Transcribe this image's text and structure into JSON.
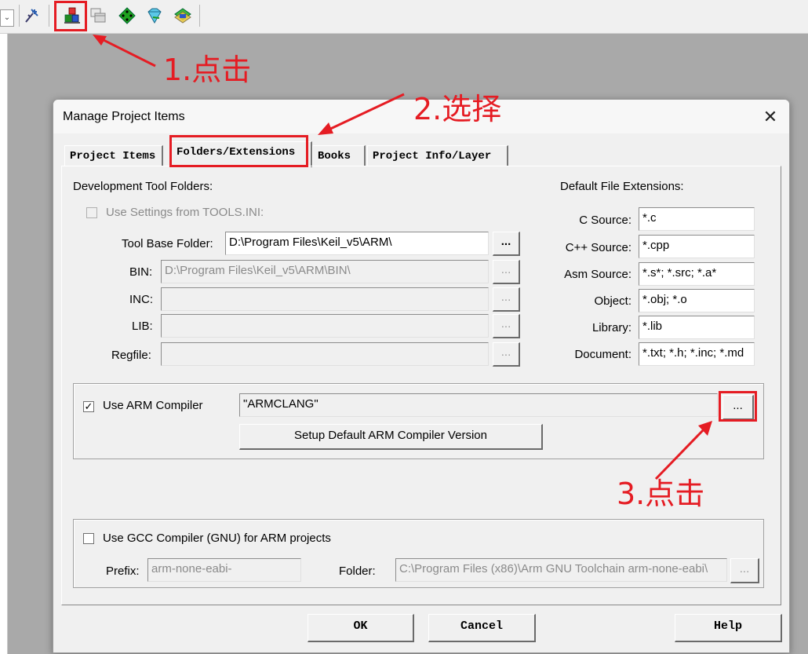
{
  "dialog": {
    "title": "Manage Project Items",
    "close_glyph": "✕",
    "tabs": [
      {
        "label": "Project Items"
      },
      {
        "label": "Folders/Extensions"
      },
      {
        "label": "Books"
      },
      {
        "label": "Project Info/Layer"
      }
    ],
    "active_tab": "Folders/Extensions"
  },
  "folders": {
    "section_title": "Development Tool Folders:",
    "use_tools_ini": {
      "label": "Use Settings from TOOLS.INI:",
      "checked": false
    },
    "tool_base": {
      "label": "Tool Base Folder:",
      "value": "D:\\Program Files\\Keil_v5\\ARM\\"
    },
    "bin": {
      "label": "BIN:",
      "value": "D:\\Program Files\\Keil_v5\\ARM\\BIN\\"
    },
    "inc": {
      "label": "INC:",
      "value": ""
    },
    "lib": {
      "label": "LIB:",
      "value": ""
    },
    "regfile": {
      "label": "Regfile:",
      "value": ""
    },
    "browse_label": "..."
  },
  "extensions": {
    "section_title": "Default File Extensions:",
    "c_source": {
      "label": "C Source:",
      "value": "*.c"
    },
    "cpp_source": {
      "label": "C++ Source:",
      "value": "*.cpp"
    },
    "asm_source": {
      "label": "Asm Source:",
      "value": "*.s*; *.src; *.a*"
    },
    "object": {
      "label": "Object:",
      "value": "*.obj; *.o"
    },
    "library": {
      "label": "Library:",
      "value": "*.lib"
    },
    "document": {
      "label": "Document:",
      "value": "*.txt; *.h; *.inc; *.md"
    }
  },
  "arm_compiler": {
    "checkbox_label": "Use ARM Compiler",
    "checked": true,
    "check_glyph": "✓",
    "value": "\"ARMCLANG\"",
    "browse_label": "...",
    "setup_button": "Setup Default ARM Compiler Version"
  },
  "gcc": {
    "checkbox_label": "Use GCC Compiler (GNU) for ARM projects",
    "checked": false,
    "prefix_label": "Prefix:",
    "prefix_value": "arm-none-eabi-",
    "folder_label": "Folder:",
    "folder_value": "C:\\Program Files (x86)\\Arm GNU Toolchain arm-none-eabi\\",
    "browse_label": "..."
  },
  "footer": {
    "ok": "OK",
    "cancel": "Cancel",
    "help": "Help"
  },
  "annotations": {
    "step1": "1.点击",
    "step2": "2.选择",
    "step3": "3.点击",
    "color": "#e51c23"
  },
  "toolbar": {
    "icons": [
      "dropdown-icon",
      "wizard-icon",
      "manage-project-items-icon",
      "window-layout-icon",
      "debug-diamond-icon",
      "gem-icon",
      "layers-icon"
    ]
  }
}
